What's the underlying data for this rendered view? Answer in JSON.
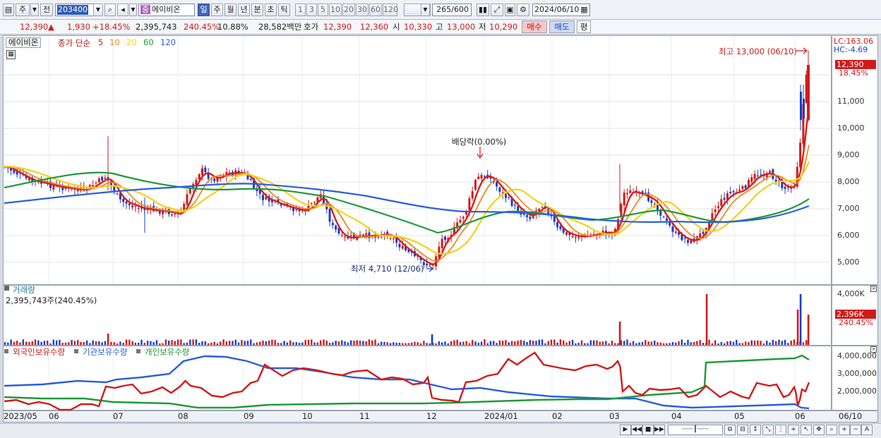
{
  "toolbar": {
    "mode_label": "주",
    "prev_label": "전",
    "code": "203400",
    "stock_tag": "중",
    "stock_name": "에이비온",
    "periods": [
      "일",
      "주",
      "월",
      "년",
      "분",
      "초",
      "틱"
    ],
    "intervals": [
      "1",
      "3",
      "5",
      "10",
      "20",
      "30",
      "60",
      "120"
    ],
    "count": "265/600",
    "date": "2024/06/10"
  },
  "quote": {
    "price": "12,390",
    "change_arrow": "▲",
    "change": "1,930",
    "change_pct": "+18.45%",
    "volume": "2,395,743",
    "volume_pct": "240.45%",
    "turnover_pct": "10.88%",
    "amount": "28,582백만",
    "hoga_label": "호가",
    "ask": "12,390",
    "bid": "12,360",
    "open_label": "시",
    "open": "10,330",
    "high_label": "고",
    "high": "13,000",
    "low_label": "저",
    "low": "10,290",
    "buy_label": "매수",
    "sell_label": "매도",
    "eval_label": "평"
  },
  "price_pane": {
    "stock_label": "에이비온",
    "legend_prefix": "종가 단순",
    "ma_labels": [
      "5",
      "10",
      "20",
      "60",
      "120"
    ],
    "ma_colors": [
      "#d81e1e",
      "#f08a1c",
      "#f2d21a",
      "#1e9a3a",
      "#2a5ee0"
    ],
    "lc": "LC:163.06",
    "hc": "HC:-4.69",
    "high_note": "최고 13,000 (06/10)",
    "low_note": "최저 4,710 (12/06)",
    "dividend_note": "배당락(0.00%)",
    "last_price_tag": "12,390",
    "last_pct_tag": "18.45%",
    "y_ticks": [
      "11,000",
      "10,000",
      "9,000",
      "8,000",
      "7,000",
      "6,000",
      "5,000"
    ]
  },
  "volume_pane": {
    "title": "거래량",
    "value": "2,395,743주(240.45%)",
    "y_tick": "4,000K",
    "last_tag": "2,396K",
    "last_pct_tag": "240.45%"
  },
  "holding_pane": {
    "series": [
      {
        "name": "외국인보유수량",
        "color": "#d21a1a"
      },
      {
        "name": "기관보유수량",
        "color": "#2a5ee0"
      },
      {
        "name": "개인보유수량",
        "color": "#1e9a3a"
      }
    ],
    "y_ticks": [
      "4,000,000",
      "3,000,000",
      "2,000,000"
    ]
  },
  "x_axis": {
    "labels": [
      "2023/05",
      "06",
      "07",
      "08",
      "09",
      "10",
      "11",
      "12",
      "2024/01",
      "02",
      "03",
      "04",
      "05",
      "06"
    ],
    "right_label": "06/10"
  }
}
